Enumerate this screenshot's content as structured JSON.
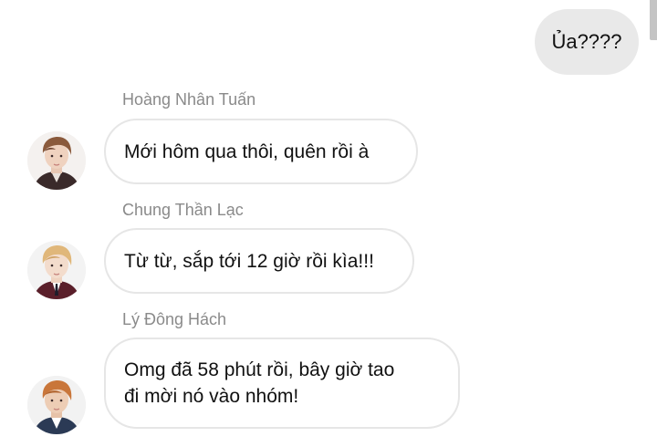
{
  "scroll": {
    "scrollbar_icon": "scrollbar-thumb"
  },
  "outgoing": [
    {
      "text": "Ủa????"
    }
  ],
  "incoming": [
    {
      "sender": "Hoàng Nhân Tuấn",
      "text": "Mới hôm qua thôi, quên rồi à",
      "avatar": "avatar-photo"
    },
    {
      "sender": "Chung Thần Lạc",
      "text": "Từ từ, sắp tới 12 giờ rồi kìa!!!",
      "avatar": "avatar-photo"
    },
    {
      "sender": "Lý Đông Hách",
      "text": "Omg đã 58 phút rồi, bây giờ tao\nđi mời nó vào nhóm!",
      "avatar": "avatar-photo"
    }
  ],
  "colors": {
    "outgoing_bubble": "#e9e9e9",
    "incoming_border": "#e6e6e6",
    "sender_name": "#8a8a8a"
  }
}
